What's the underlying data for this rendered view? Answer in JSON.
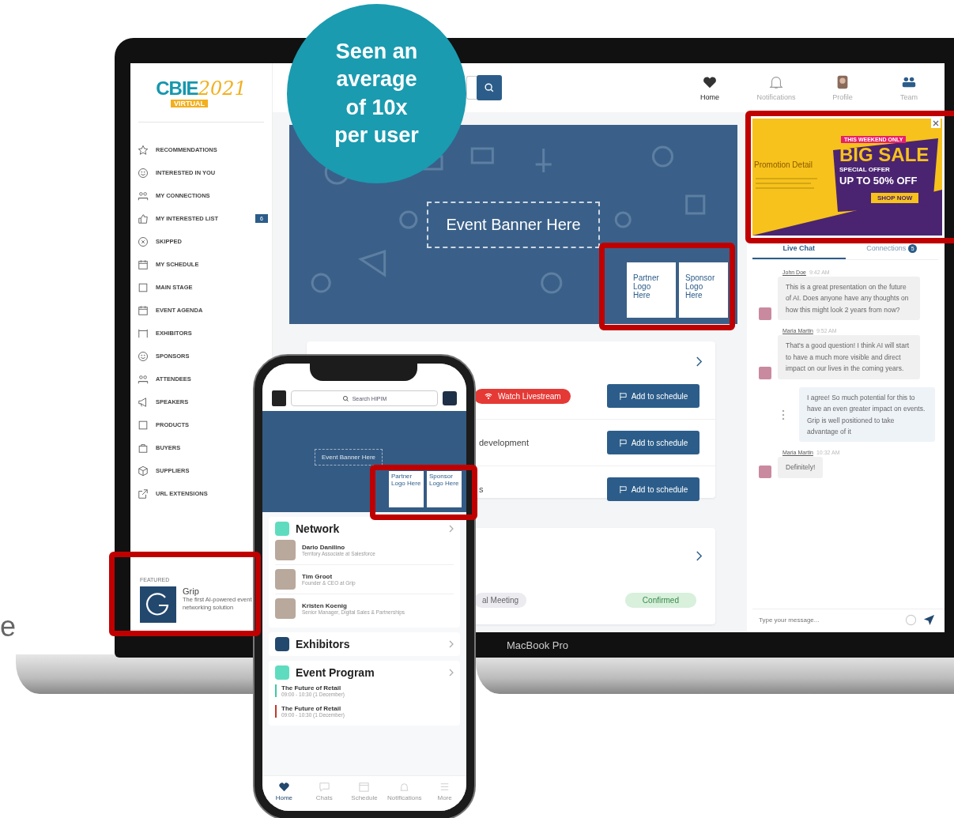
{
  "callout": {
    "text": "Seen an average of 10x per user"
  },
  "fragment": "e",
  "laptop": {
    "label": "MacBook Pro",
    "logo": {
      "name": "CBIE",
      "year": "2021",
      "tag": "VIRTUAL"
    },
    "sidebar": {
      "items": [
        {
          "label": "RECOMMENDATIONS"
        },
        {
          "label": "INTERESTED IN YOU"
        },
        {
          "label": "MY CONNECTIONS"
        },
        {
          "label": "MY INTERESTED LIST",
          "badge": "6"
        },
        {
          "label": "SKIPPED"
        },
        {
          "label": "MY SCHEDULE"
        },
        {
          "label": "MAIN STAGE"
        },
        {
          "label": "EVENT AGENDA"
        },
        {
          "label": "EXHIBITORS"
        },
        {
          "label": "SPONSORS"
        },
        {
          "label": "ATTENDEES"
        },
        {
          "label": "SPEAKERS"
        },
        {
          "label": "PRODUCTS"
        },
        {
          "label": "BUYERS"
        },
        {
          "label": "SUPPLIERS"
        },
        {
          "label": "URL EXTENSIONS"
        }
      ]
    },
    "featured": {
      "heading": "FEATURED",
      "name": "Grip",
      "description": "The first AI-powered event networking solution"
    },
    "nav": [
      {
        "label": "Home",
        "selected": true
      },
      {
        "label": "Notifications",
        "selected": false
      },
      {
        "label": "Profile",
        "selected": false
      },
      {
        "label": "Team",
        "selected": false
      }
    ],
    "banner": {
      "text": "Event Banner Here",
      "logos": [
        "Partner Logo Here",
        "Sponsor Logo Here"
      ]
    },
    "sessions": [
      {
        "kind": "live",
        "text": "Watch Livestream",
        "action": "Add to schedule"
      },
      {
        "kind": "title",
        "text": "development",
        "action": "Add to schedule"
      },
      {
        "kind": "title",
        "text": "s",
        "action": "Add to schedule"
      }
    ],
    "meeting": {
      "tag": "al Meeting",
      "status": "Confirmed"
    },
    "ad": {
      "title": "Promotion Detail",
      "ribbon": "THIS WEEKEND ONLY",
      "headline": "BIG SALE",
      "offer": "SPECIAL OFFER",
      "discount": "UP TO 50% OFF",
      "cta": "SHOP NOW"
    },
    "chat": {
      "tabs": [
        {
          "label": "Live Chat",
          "selected": true
        },
        {
          "label": "Connections",
          "badge": "5",
          "selected": false
        }
      ],
      "messages": [
        {
          "kind": "incoming",
          "author": "John Doe",
          "time": "9:42 AM",
          "text": "This is a great presentation on the future of AI. Does anyone have any thoughts on how this might look 2 years from now?"
        },
        {
          "kind": "incoming",
          "author": "Maria Martin",
          "time": "9:52 AM",
          "text": "That's a good question! I think AI will start to have a much more visible and direct impact on our lives in the coming years."
        },
        {
          "kind": "outgoing",
          "text": "I agree! So much potential for this to have an even greater impact on events. Grip is well positioned to take advantage of it"
        },
        {
          "kind": "incoming",
          "author": "Maria Martin",
          "time": "10:32 AM",
          "text": "Definitely!"
        }
      ],
      "input": {
        "placeholder": "Type your message..."
      }
    }
  },
  "phone": {
    "search": {
      "placeholder": "Search HIPIM"
    },
    "banner": {
      "text": "Event Banner Here",
      "logos": [
        "Partner Logo Here",
        "Sponsor Logo Here"
      ]
    },
    "network": {
      "title": "Network",
      "people": [
        {
          "name": "Dario Danilino",
          "role": "Territory Associate at Salesforce"
        },
        {
          "name": "Tim Groot",
          "role": "Founder & CEO at Grip"
        },
        {
          "name": "Kristen Koenig",
          "role": "Senior Manager, Digital Sales & Partnerships"
        }
      ]
    },
    "exhibitors": {
      "title": "Exhibitors"
    },
    "program": {
      "title": "Event Program",
      "events": [
        {
          "title": "The Future of Retail",
          "time": "09:00 - 10:30 (1 December)",
          "color": "#3fc7a8"
        },
        {
          "title": "The Future of Retail",
          "time": "09:00 - 10:30 (1 December)",
          "color": "#c0392b"
        }
      ]
    },
    "tabs": [
      {
        "label": "Home",
        "selected": true
      },
      {
        "label": "Chats",
        "selected": false
      },
      {
        "label": "Schedule",
        "selected": false
      },
      {
        "label": "Notifications",
        "selected": false
      },
      {
        "label": "More",
        "selected": false
      }
    ]
  }
}
